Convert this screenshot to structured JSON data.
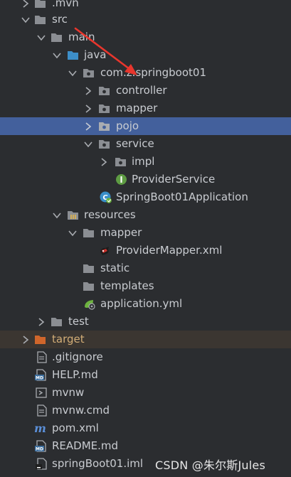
{
  "tree": {
    "items": [
      {
        "label": ".mvn",
        "icon": "folder-icon",
        "chevron": "right"
      },
      {
        "label": "src",
        "icon": "folder-icon",
        "chevron": "down"
      },
      {
        "label": "main",
        "icon": "folder-icon",
        "chevron": "down"
      },
      {
        "label": "java",
        "icon": "source-folder-icon",
        "chevron": "down"
      },
      {
        "label": "com.z.springboot01",
        "icon": "package-icon",
        "chevron": "down"
      },
      {
        "label": "controller",
        "icon": "package-icon",
        "chevron": "right"
      },
      {
        "label": "mapper",
        "icon": "package-icon",
        "chevron": "right"
      },
      {
        "label": "pojo",
        "icon": "package-icon",
        "chevron": "right",
        "state": "selected"
      },
      {
        "label": "service",
        "icon": "package-icon",
        "chevron": "down"
      },
      {
        "label": "impl",
        "icon": "package-icon",
        "chevron": "right"
      },
      {
        "label": "ProviderService",
        "icon": "interface-icon"
      },
      {
        "label": "SpringBoot01Application",
        "icon": "spring-boot-class-icon"
      },
      {
        "label": "resources",
        "icon": "resources-folder-icon",
        "chevron": "down"
      },
      {
        "label": "mapper",
        "icon": "folder-icon",
        "chevron": "down"
      },
      {
        "label": "ProviderMapper.xml",
        "icon": "mybatis-xml-icon"
      },
      {
        "label": "static",
        "icon": "folder-icon"
      },
      {
        "label": "templates",
        "icon": "folder-icon"
      },
      {
        "label": "application.yml",
        "icon": "spring-yml-icon"
      },
      {
        "label": "test",
        "icon": "folder-icon",
        "chevron": "right"
      },
      {
        "label": "target",
        "icon": "excluded-folder-icon",
        "chevron": "right",
        "state": "excluded"
      },
      {
        "label": ".gitignore",
        "icon": "text-file-icon"
      },
      {
        "label": "HELP.md",
        "icon": "markdown-file-icon"
      },
      {
        "label": "mvnw",
        "icon": "shell-script-icon"
      },
      {
        "label": "mvnw.cmd",
        "icon": "text-file-icon"
      },
      {
        "label": "pom.xml",
        "icon": "maven-icon"
      },
      {
        "label": "README.md",
        "icon": "markdown-file-icon"
      },
      {
        "label": "springBoot01.iml",
        "icon": "iml-file-icon"
      }
    ]
  },
  "watermark": {
    "text": "CSDN @朱尔斯Jules"
  },
  "colors": {
    "background": "#2b2d30",
    "selected_row": "#43609c",
    "excluded_row": "#3b3631",
    "excluded_text": "#d2ad77",
    "text": "#c9ccd1",
    "annotation_arrow": "#e8362d"
  }
}
